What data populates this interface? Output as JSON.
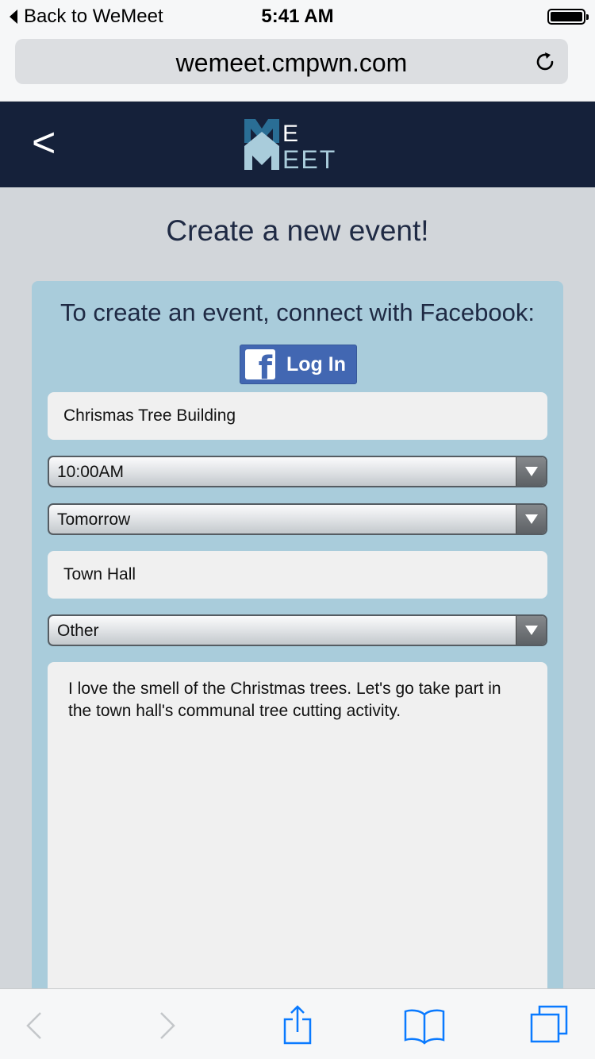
{
  "status_bar": {
    "back_label": "Back to WeMeet",
    "time": "5:41 AM"
  },
  "browser": {
    "url": "wemeet.cmpwn.com"
  },
  "header": {
    "back_symbol": "<",
    "logo_text": "WeMeet"
  },
  "page": {
    "title": "Create a new event!"
  },
  "form": {
    "facebook_prompt": "To create an event, connect with Facebook:",
    "facebook_button_label": "Log In",
    "event_name": "Chrismas Tree Building",
    "time": "10:00AM",
    "day": "Tomorrow",
    "location": "Town Hall",
    "category": "Other",
    "description": "I love the smell of the Christmas trees. Let's go take part in the town hall's communal tree cutting activity."
  },
  "colors": {
    "header_bg": "#15213a",
    "card_bg": "#a9ccdb",
    "page_bg": "#d2d6da",
    "facebook_blue": "#4267b2",
    "ios_blue": "#0a7aff"
  },
  "icons": {
    "reload": "reload-icon",
    "toolbar": [
      "back-icon",
      "forward-icon",
      "share-icon",
      "bookmarks-icon",
      "tabs-icon"
    ]
  }
}
